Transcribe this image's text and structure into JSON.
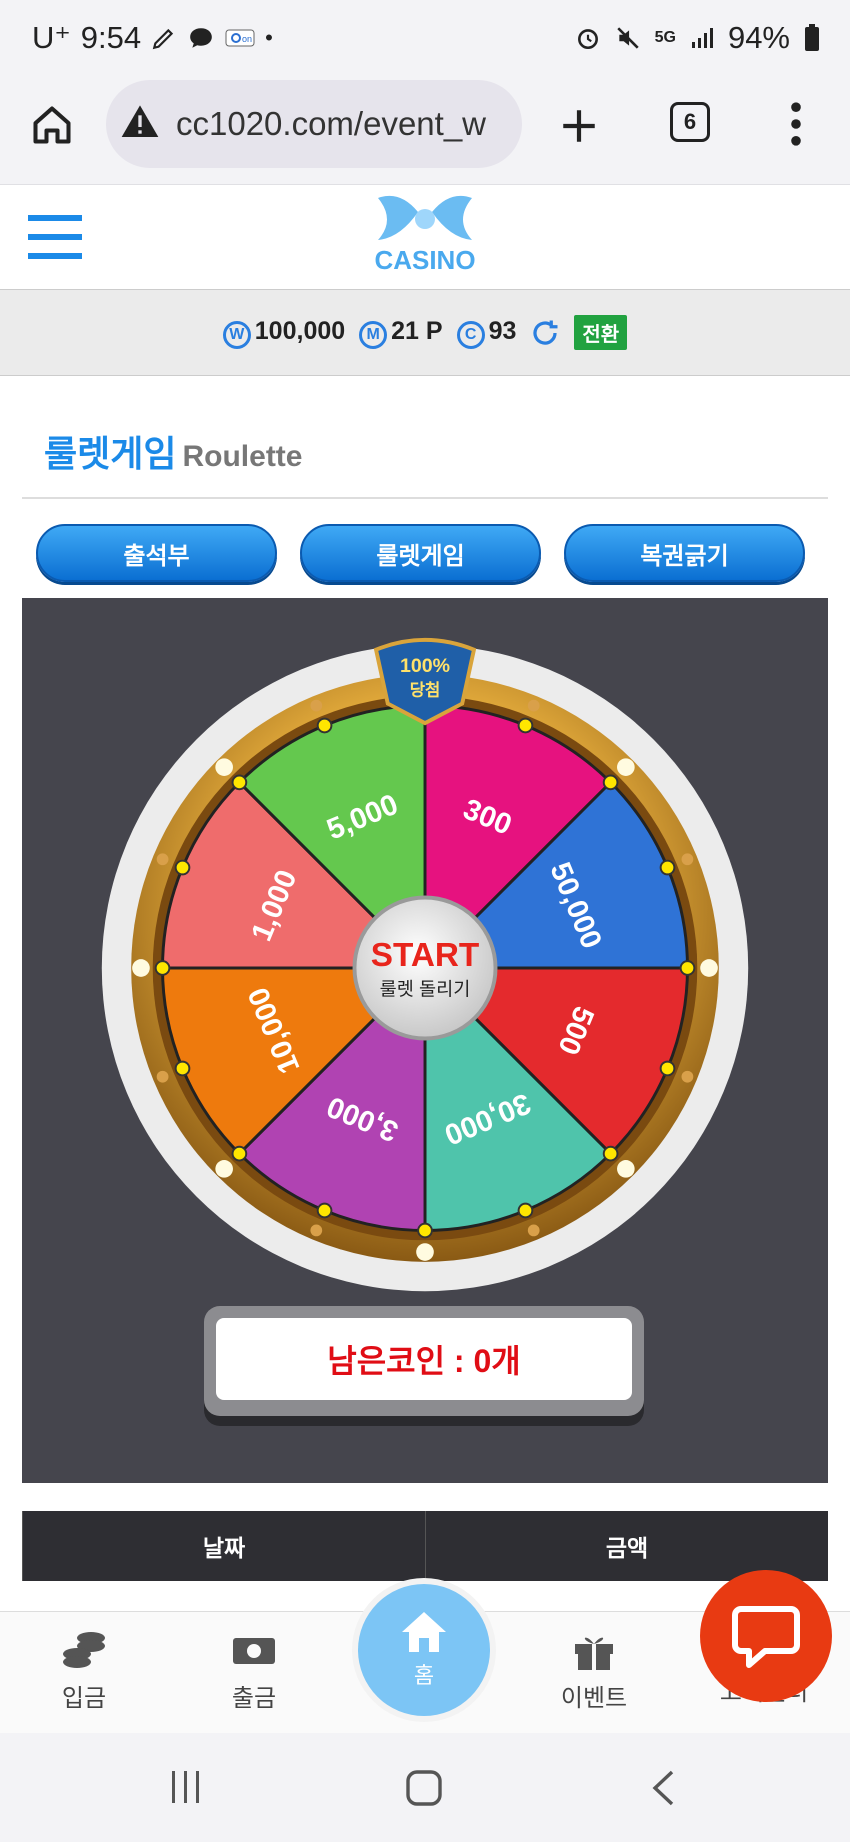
{
  "status_bar": {
    "carrier": "U⁺",
    "time": "9:54",
    "network": "5G",
    "battery": "94%"
  },
  "browser": {
    "url": "cc1020.com/event_w",
    "tab_count": "6"
  },
  "site": {
    "logo_text": "CASINO"
  },
  "balance": {
    "won_icon": "W",
    "won": "100,000",
    "point_icon": "M",
    "points": "21 P",
    "coin_icon": "C",
    "coins": "93",
    "convert_label": "전환"
  },
  "page": {
    "title_ko": "룰렛게임",
    "title_en": "Roulette"
  },
  "tabs": [
    "출석부",
    "룰렛게임",
    "복권긁기"
  ],
  "roulette": {
    "badge_top": "100%",
    "badge_bottom": "당첨",
    "start_label": "START",
    "start_sub": "룰렛 돌리기",
    "segments": [
      {
        "label": "300",
        "color": "#e6127f"
      },
      {
        "label": "50,000",
        "color": "#2f73d6"
      },
      {
        "label": "500",
        "color": "#e42a2d"
      },
      {
        "label": "30,000",
        "color": "#4fc4ab"
      },
      {
        "label": "3,000",
        "color": "#b043b2"
      },
      {
        "label": "10,000",
        "color": "#ee7a0d"
      },
      {
        "label": "1,000",
        "color": "#ef6c6c"
      },
      {
        "label": "5,000",
        "color": "#64c84e"
      }
    ],
    "remaining": "남은코인 : 0개"
  },
  "table_headers": [
    "날짜",
    "금액"
  ],
  "bottom_nav": {
    "deposit": "입금",
    "withdraw": "출금",
    "home": "홈",
    "event": "이벤트",
    "support": "고객센터"
  },
  "colors": {
    "accent": "#1b8ae8",
    "convert": "#21a240",
    "remaining": "#e00d15",
    "chat": "#e83a12"
  }
}
